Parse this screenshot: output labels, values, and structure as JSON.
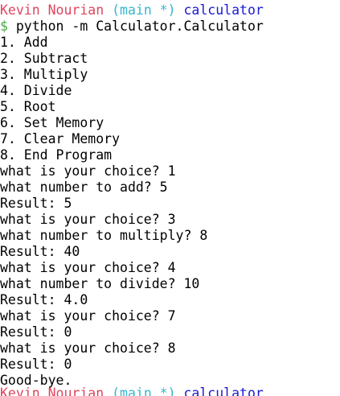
{
  "prompt": {
    "user": "Kevin Nourian",
    "branch": "(main *)",
    "dir": "calculator",
    "dollar": "$",
    "command": "python -m Calculator.Calculator"
  },
  "lines": [
    "1. Add",
    "2. Subtract",
    "3. Multiply",
    "4. Divide",
    "5. Root",
    "6. Set Memory",
    "7. Clear Memory",
    "8. End Program",
    "what is your choice? 1",
    "what number to add? 5",
    "Result: 5",
    "what is your choice? 3",
    "what number to multiply? 8",
    "Result: 40",
    "what is your choice? 4",
    "what number to divide? 10",
    "Result: 4.0",
    "what is your choice? 7",
    "Result: 0",
    "what is your choice? 8",
    "Result: 0",
    "Good-bye."
  ],
  "colors": {
    "user": "#e0445c",
    "branch": "#35b7cf",
    "dir": "#1818d6",
    "dollar": "#4aa84a"
  }
}
